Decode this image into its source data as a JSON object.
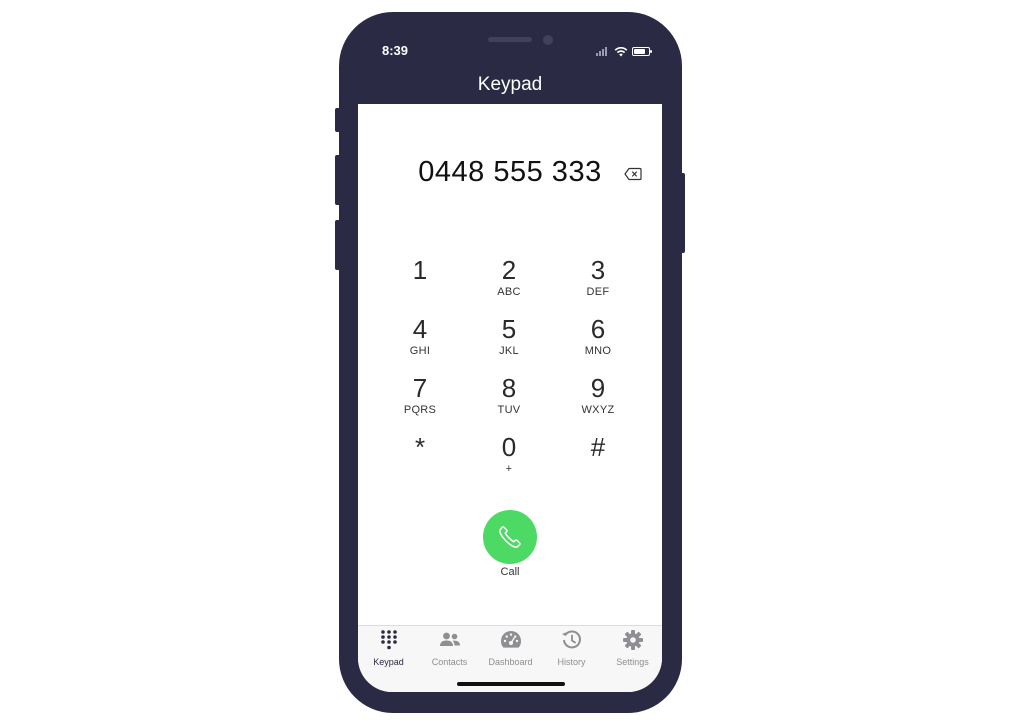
{
  "status": {
    "time": "8:39"
  },
  "nav": {
    "title": "Keypad"
  },
  "dialer": {
    "number": "0448 555 333"
  },
  "keys": [
    {
      "digit": "1",
      "letters": ""
    },
    {
      "digit": "2",
      "letters": "ABC"
    },
    {
      "digit": "3",
      "letters": "DEF"
    },
    {
      "digit": "4",
      "letters": "GHI"
    },
    {
      "digit": "5",
      "letters": "JKL"
    },
    {
      "digit": "6",
      "letters": "MNO"
    },
    {
      "digit": "7",
      "letters": "PQRS"
    },
    {
      "digit": "8",
      "letters": "TUV"
    },
    {
      "digit": "9",
      "letters": "WXYZ"
    },
    {
      "digit": "*",
      "letters": ""
    },
    {
      "digit": "0",
      "letters": "+"
    },
    {
      "digit": "#",
      "letters": ""
    }
  ],
  "call": {
    "label": "Call",
    "icon": "phone-icon",
    "color": "#4cd964"
  },
  "tabs": [
    {
      "label": "Keypad",
      "icon": "keypad-icon",
      "active": true
    },
    {
      "label": "Contacts",
      "icon": "contacts-icon",
      "active": false
    },
    {
      "label": "Dashboard",
      "icon": "dashboard-icon",
      "active": false
    },
    {
      "label": "History",
      "icon": "history-icon",
      "active": false
    },
    {
      "label": "Settings",
      "icon": "settings-icon",
      "active": false
    }
  ],
  "colors": {
    "frame": "#2a2a44",
    "accent": "#4cd964",
    "inactive": "#8e8e93"
  }
}
